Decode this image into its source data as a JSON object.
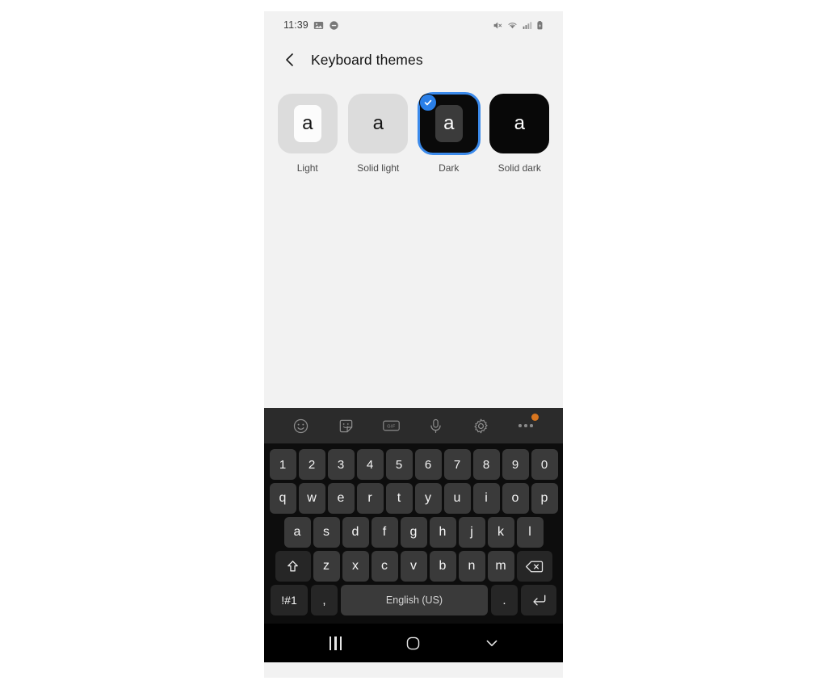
{
  "status_bar": {
    "time": "11:39",
    "left_icons": [
      "image-icon",
      "dnd-icon"
    ],
    "right_icons": [
      "mute-icon",
      "wifi-icon",
      "signal-icon",
      "battery-icon"
    ]
  },
  "header": {
    "back_label": "Back",
    "title": "Keyboard themes"
  },
  "themes": {
    "selected": "Dark",
    "accent_color": "#2a7fe8",
    "items": [
      {
        "label": "Light",
        "letter": "a",
        "style": "light"
      },
      {
        "label": "Solid light",
        "letter": "a",
        "style": "solid-light"
      },
      {
        "label": "Dark",
        "letter": "a",
        "style": "dark",
        "selected": true
      },
      {
        "label": "Solid dark",
        "letter": "a",
        "style": "solid-dark"
      }
    ]
  },
  "keyboard": {
    "toolbar": {
      "items": [
        {
          "name": "emoji-icon",
          "badge": false
        },
        {
          "name": "sticker-icon",
          "badge": false
        },
        {
          "name": "gif-icon",
          "label": "GIF",
          "badge": false
        },
        {
          "name": "microphone-icon",
          "badge": false
        },
        {
          "name": "settings-gear-icon",
          "badge": false
        },
        {
          "name": "more-options-icon",
          "badge": true,
          "badge_color": "#d9761f"
        }
      ]
    },
    "rows": {
      "numbers": [
        "1",
        "2",
        "3",
        "4",
        "5",
        "6",
        "7",
        "8",
        "9",
        "0"
      ],
      "top": [
        "q",
        "w",
        "e",
        "r",
        "t",
        "y",
        "u",
        "i",
        "o",
        "p"
      ],
      "home": [
        "a",
        "s",
        "d",
        "f",
        "g",
        "h",
        "j",
        "k",
        "l"
      ],
      "bottom": [
        "z",
        "x",
        "c",
        "v",
        "b",
        "n",
        "m"
      ]
    },
    "shift_label": "Shift",
    "backspace_label": "Backspace",
    "symbols_label": "!#1",
    "comma_label": ",",
    "space_label": "English (US)",
    "period_label": ".",
    "enter_label": "Enter"
  },
  "nav_bar": {
    "recents_label": "Recents",
    "home_label": "Home",
    "back_label": "Hide keyboard"
  }
}
